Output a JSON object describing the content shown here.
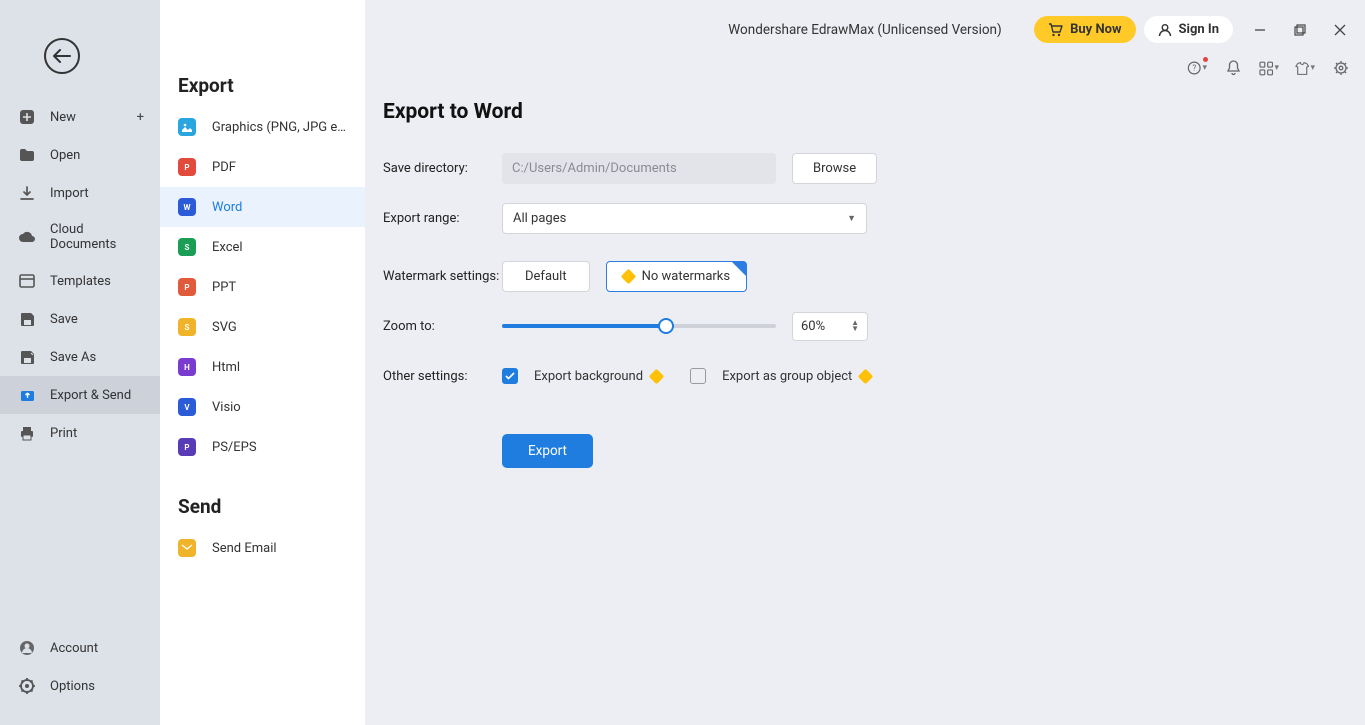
{
  "app_title": "Wondershare EdrawMax (Unlicensed Version)",
  "header": {
    "buy_now": "Buy Now",
    "sign_in": "Sign In"
  },
  "sidebar": {
    "items": [
      {
        "label": "New"
      },
      {
        "label": "Open"
      },
      {
        "label": "Import"
      },
      {
        "label": "Cloud Documents"
      },
      {
        "label": "Templates"
      },
      {
        "label": "Save"
      },
      {
        "label": "Save As"
      },
      {
        "label": "Export & Send"
      },
      {
        "label": "Print"
      }
    ],
    "account": "Account",
    "options": "Options"
  },
  "export": {
    "heading": "Export",
    "formats": [
      {
        "label": "Graphics (PNG, JPG e...",
        "color": "#29a5e0"
      },
      {
        "label": "PDF",
        "color": "#e24a3b"
      },
      {
        "label": "Word",
        "color": "#2b5bd7"
      },
      {
        "label": "Excel",
        "color": "#1a9e55"
      },
      {
        "label": "PPT",
        "color": "#e05a3b"
      },
      {
        "label": "SVG",
        "color": "#f0b42b"
      },
      {
        "label": "Html",
        "color": "#7a3bd1"
      },
      {
        "label": "Visio",
        "color": "#2b5bd7"
      },
      {
        "label": "PS/EPS",
        "color": "#5a3bb7"
      }
    ],
    "send_heading": "Send",
    "send_email": "Send Email"
  },
  "panel": {
    "title": "Export to Word",
    "save_directory_label": "Save directory:",
    "save_directory_value": "C:/Users/Admin/Documents",
    "browse": "Browse",
    "export_range_label": "Export range:",
    "export_range_value": "All pages",
    "watermark_label": "Watermark settings:",
    "watermark_default": "Default",
    "watermark_none": "No watermarks",
    "zoom_label": "Zoom to:",
    "zoom_value": "60%",
    "other_label": "Other settings:",
    "export_background": "Export background",
    "export_group": "Export as group object",
    "export_button": "Export"
  }
}
